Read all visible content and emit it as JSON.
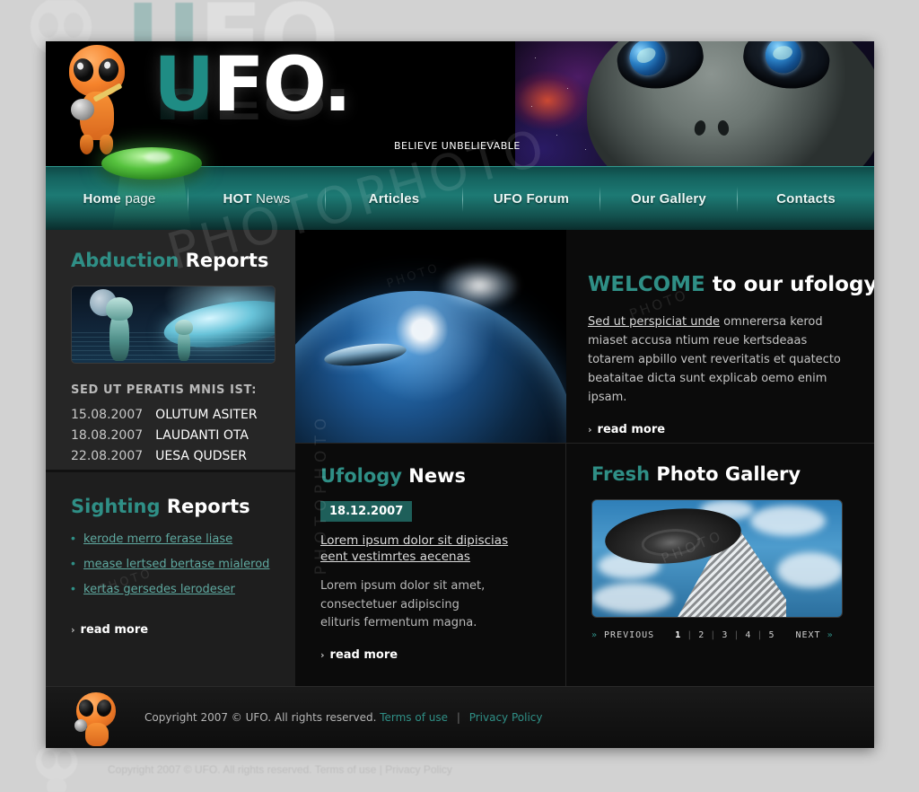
{
  "site": {
    "logo": {
      "part_teal": "U",
      "part_white": "FO",
      "dot": "."
    },
    "tagline": "BELIEVE UNBELIEVABLE"
  },
  "nav": {
    "items": [
      {
        "bold": "Home",
        "light": " page",
        "active": true
      },
      {
        "bold": "HOT",
        "light": " News",
        "active": false
      },
      {
        "bold": "Articles",
        "light": "",
        "active": false
      },
      {
        "bold": "UFO Forum",
        "light": "",
        "active": false
      },
      {
        "bold": "Our Gallery",
        "light": "",
        "active": false
      },
      {
        "bold": "Contacts",
        "light": "",
        "active": false
      }
    ]
  },
  "sidebar": {
    "abduction": {
      "title_accent": "Abduction",
      "title_rest": " Reports",
      "image_alt": "alien-abduction-scene",
      "caption": "SED UT PERATIS MNIS IST:",
      "entries": [
        {
          "date": "15.08.2007",
          "title": "OLUTUM ASITER"
        },
        {
          "date": "18.08.2007",
          "title": "LAUDANTI OTA"
        },
        {
          "date": "22.08.2007",
          "title": "UESA QUDSER"
        }
      ]
    },
    "sighting": {
      "title_accent": "Sighting",
      "title_rest": " Reports",
      "links": [
        "kerode merro ferase liase",
        "mease lertsed bertase mialerod",
        "kertas gersedes lerodeser"
      ],
      "read_more": "read more"
    }
  },
  "welcome": {
    "title_accent": "WELCOME",
    "title_rest": " to our ufology site!",
    "link_text": "Sed ut perspiciat unde",
    "body": " omnerersa kerod miaset accusa ntium reue kertsdeaas totarem apbillo vent reveritatis et quatecto beataitae dicta sunt explicab oemo enim ipsam.",
    "read_more": "read more",
    "image_alt": "earth-from-space-with-ufo"
  },
  "news": {
    "title_accent": "Ufology",
    "title_rest": " News",
    "date": "18.12.2007",
    "headline": "Lorem ipsum dolor sit dipiscias eent vestimrtes aecenas",
    "body": "Lorem ipsum dolor sit amet, consectetuer adipiscing elituris fermentum magna.",
    "read_more": "read more"
  },
  "gallery": {
    "title_accent": "Fresh",
    "title_rest": " Photo Gallery",
    "image_alt": "ufo-over-skyscraper",
    "pagination": {
      "previous": "PREVIOUS",
      "next": "NEXT",
      "pages": [
        "1",
        "2",
        "3",
        "4",
        "5"
      ],
      "active_page": "1",
      "separator": "|"
    }
  },
  "footer": {
    "copyright": "Copyright 2007 © UFO. All rights reserved.",
    "terms": "Terms of use",
    "privacy": "Privacy Policy",
    "separator": "|"
  },
  "watermarks": {
    "w1": "PHOTOPHOTO",
    "w2": "PHOTOPHOTO",
    "w3": "PHOTO",
    "w4": "PHOTO",
    "w5": "PHOTO",
    "w6": "PHOTO"
  },
  "colors": {
    "accent_teal": "#2f8f86",
    "logo_teal": "#1f8c84",
    "badge_teal": "#1e5f5a",
    "nav_teal": "#1d7a74",
    "page_bg": "#d2d2d2",
    "site_bg": "#000000",
    "sidebar_bg": "#262626",
    "main_bg": "#0b0b0b"
  }
}
